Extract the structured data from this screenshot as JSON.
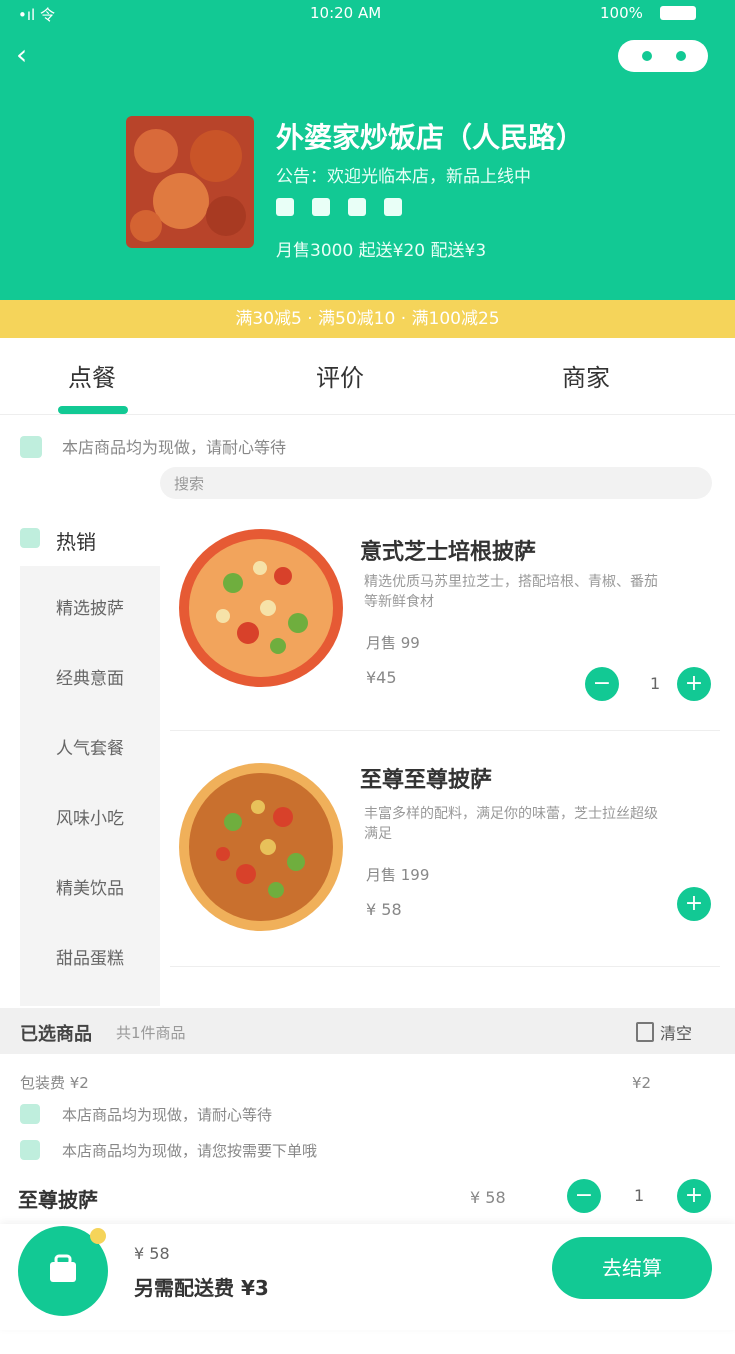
{
  "colors": {
    "brand": "#12c994",
    "promo": "#f5d45a",
    "price_gray": "#888888"
  },
  "status_bar": {
    "signal": "•ıl 令",
    "time": "10:20 AM",
    "battery_text": "100%"
  },
  "header": {
    "back_icon": "back-icon",
    "shop_name": "外婆家炒饭店（人民路）",
    "notice": "公告：欢迎光临本店，新品上线中",
    "meta": "月售3000  起送¥20  配送¥3",
    "promo_text": "满30减5 · 满50减10 · 满100减25"
  },
  "tabs": [
    {
      "label": "点餐"
    },
    {
      "label": "评价"
    },
    {
      "label": "商家"
    }
  ],
  "notice_text": "本店商品均为现做，请耐心等待",
  "search": {
    "placeholder": "搜索"
  },
  "categories": {
    "hot": "热销",
    "items": [
      "精选披萨",
      "经典意面",
      "人气套餐",
      "风味小吃",
      "精美饮品",
      "甜品蛋糕"
    ]
  },
  "products": [
    {
      "name": "意式芝士培根披萨",
      "desc": "精选优质马苏里拉芝士，搭配培根、青椒、番茄等新鲜食材",
      "sales": "月售 99",
      "price": "¥45",
      "qty": "1"
    },
    {
      "name": "至尊至尊披萨",
      "desc": "丰富多样的配料，满足你的味蕾，芝士拉丝超级满足",
      "sales": "月售 199",
      "price": "¥ 58",
      "qty": ""
    }
  ],
  "cart": {
    "title": "已选商品",
    "subtitle": "共1件商品",
    "clear": "清空",
    "note": "包装费 ¥2",
    "note_value": "¥2",
    "line1": "本店商品均为现做，请耐心等待",
    "line2": "本店商品均为现做，请您按需要下单哦",
    "item_name": "至尊披萨",
    "item_price": "¥ 58",
    "item_qty": "1"
  },
  "bottom": {
    "total_label": "¥ 58",
    "total_sub": "另需配送费 ¥3",
    "checkout": "去结算"
  }
}
